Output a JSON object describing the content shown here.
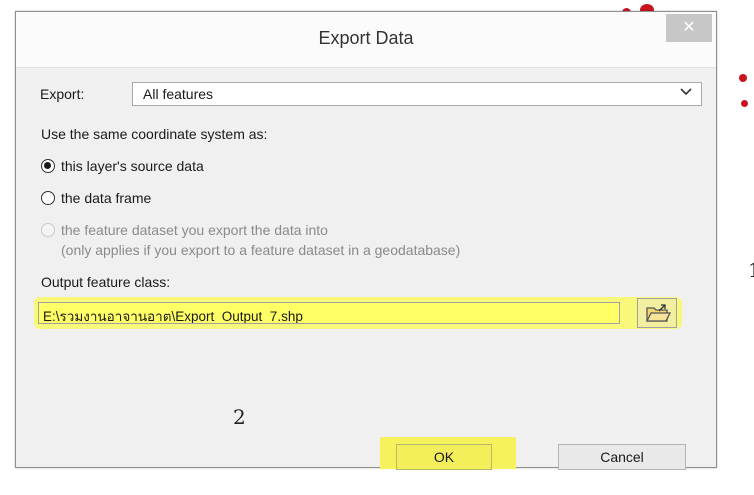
{
  "dialog": {
    "title": "Export Data",
    "close_glyph": "✕",
    "export_label": "Export:",
    "export_value": "All features",
    "coordinate_label": "Use the same coordinate system as:",
    "radio_options": [
      {
        "label": "this layer's source data",
        "checked": true,
        "enabled": true
      },
      {
        "label": "the data frame",
        "checked": false,
        "enabled": true
      },
      {
        "label": "the feature dataset you export the data into",
        "note": "(only applies if you export to a feature dataset in a geodatabase)",
        "checked": false,
        "enabled": false
      }
    ],
    "output_label": "Output feature class:",
    "output_path": "E:\\รวมงานอาจานอาต\\Export_Output_7.shp",
    "ok_label": "OK",
    "cancel_label": "Cancel"
  },
  "annotations": {
    "step1": "1",
    "step2": "2"
  },
  "colors": {
    "highlight": "#ffff66",
    "map_marker": "#c8141e"
  },
  "icons": {
    "close": "close-icon",
    "dropdown": "chevron-down-icon",
    "browse": "folder-open-icon"
  }
}
